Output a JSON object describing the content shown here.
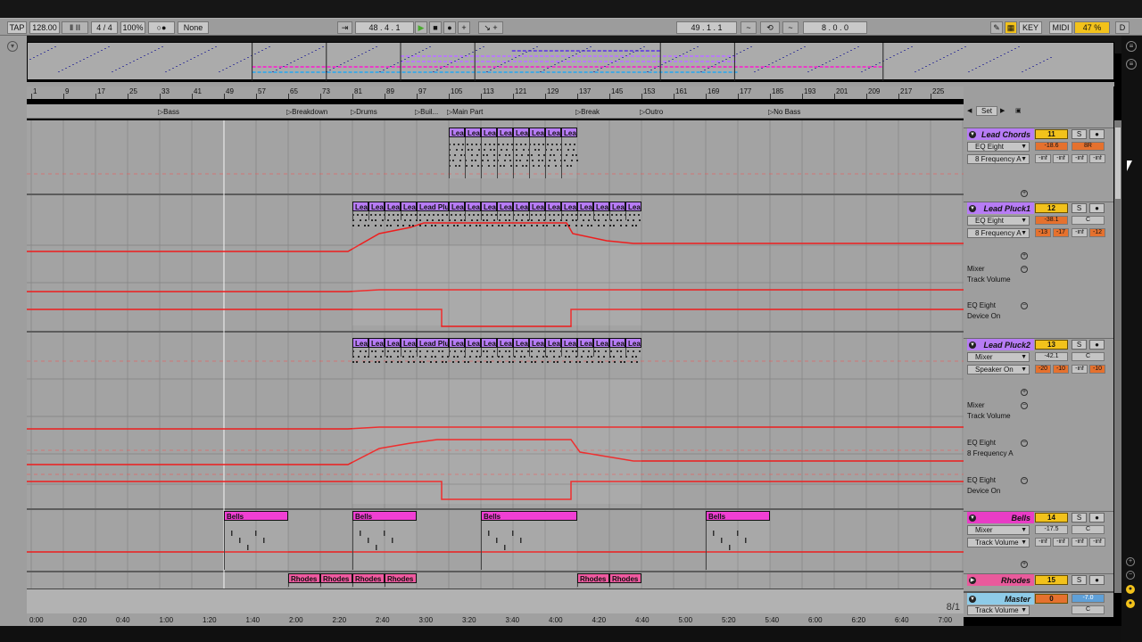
{
  "control_bar": {
    "tap": "TAP",
    "tempo": "128.00",
    "nudge": "Ⅱ  ⅠⅠ",
    "signature": "4 / 4",
    "zoom": "100%",
    "metronome": "○●",
    "quantize": "None",
    "position": "48 .   4 .   1",
    "loop_start": "49 .   1 .   1",
    "loop_length": "8 .   0 .   0",
    "key": "KEY",
    "midi": "MIDI",
    "cpu": "47 %",
    "d": "D"
  },
  "ruler": {
    "bars": [
      "1",
      "9",
      "17",
      "25",
      "33",
      "41",
      "49",
      "57",
      "65",
      "73",
      "81",
      "89",
      "97",
      "105",
      "113",
      "121",
      "129",
      "137",
      "145",
      "153",
      "161",
      "169",
      "177",
      "185",
      "193",
      "201",
      "209",
      "217",
      "225"
    ]
  },
  "locators": [
    "Bass",
    "Breakdown",
    "Drums",
    "Buil...",
    "Main Part",
    "Break",
    "Outro",
    "No Bass"
  ],
  "set_button": "Set",
  "tracks": [
    {
      "name": "Lead Chords",
      "color": "#b77cf5",
      "num": "11",
      "device": "EQ Eight",
      "param": "8 Frequency A",
      "vol": "-18.6",
      "pan": "8R",
      "sends": [
        "-inf",
        "-inf",
        "-inf",
        "-inf"
      ]
    },
    {
      "name": "Lead Pluck1",
      "color": "#b77cf5",
      "num": "12",
      "device": "EQ Eight",
      "param": "8 Frequency A",
      "vol": "-38.1",
      "pan": "C",
      "sends": [
        "-13",
        "-17",
        "-inf",
        "-12"
      ],
      "lanes": [
        {
          "device": "Mixer",
          "param": "Track Volume"
        },
        {
          "device": "EQ Eight",
          "param": "Device On"
        }
      ]
    },
    {
      "name": "Lead Pluck2",
      "color": "#b77cf5",
      "num": "13",
      "device": "Mixer",
      "param": "Speaker On",
      "vol": "-42.1",
      "pan": "C",
      "sends": [
        "-20",
        "-10",
        "-inf",
        "-10"
      ],
      "lanes": [
        {
          "device": "Mixer",
          "param": "Track Volume"
        },
        {
          "device": "EQ Eight",
          "param": "8 Frequency A"
        },
        {
          "device": "EQ Eight",
          "param": "Device On"
        }
      ]
    },
    {
      "name": "Bells",
      "color": "#e93cc6",
      "num": "14",
      "device": "Mixer",
      "param": "Track Volume",
      "vol": "-17.5",
      "pan": "C",
      "sends": [
        "-inf",
        "-inf",
        "-inf",
        "-inf"
      ]
    },
    {
      "name": "Rhodes",
      "color": "#e95a9c",
      "num": "15"
    },
    {
      "name": "Master",
      "color": "#8ecbe8",
      "num": "0",
      "param": "Track Volume",
      "vol": "-7.0",
      "pan": "C"
    }
  ],
  "buttons": {
    "solo": "S",
    "arm": "●"
  },
  "clips": {
    "lead_chords": "Lead Chords",
    "lead_pluck": "Lead Pluck",
    "lead_pluck_short": "Lead",
    "bells": "Bells",
    "rhodes": "Rhodes"
  },
  "timeline": [
    "0:00",
    "0:20",
    "0:40",
    "1:00",
    "1:20",
    "1:40",
    "2:00",
    "2:20",
    "2:40",
    "3:00",
    "3:20",
    "3:40",
    "4:00",
    "4:20",
    "4:40",
    "5:00",
    "5:20",
    "5:40",
    "6:00",
    "6:20",
    "6:40",
    "7:00"
  ],
  "grid_label": "8/1",
  "colors": {
    "automation": "#ee1d1d",
    "clip_purple": "#b77cf5",
    "clip_pink": "#f03fd3",
    "clip_rhodes": "#ef5aa0",
    "accent": "#f2c21b"
  }
}
